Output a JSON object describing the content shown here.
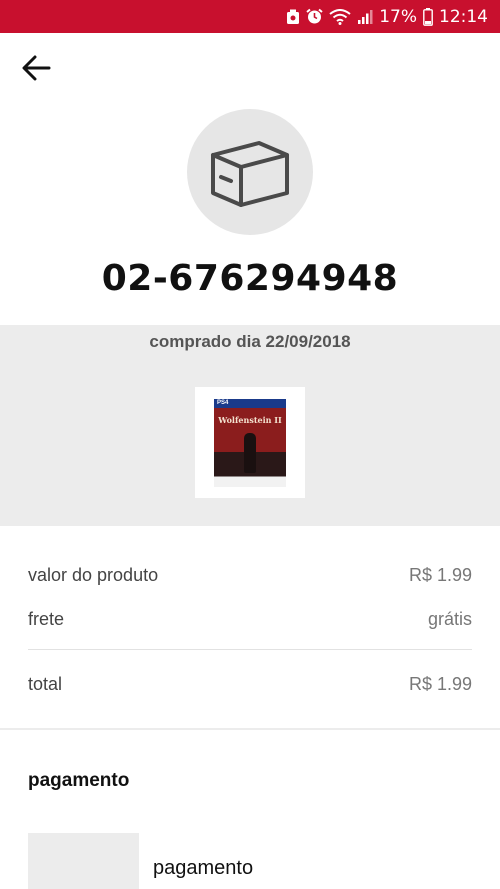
{
  "status_bar": {
    "battery_percent": "17%",
    "time": "12:14",
    "icons": [
      "screenshot-icon",
      "alarm-icon",
      "wifi-icon",
      "signal-icon",
      "battery-icon"
    ],
    "color": "#c8102e"
  },
  "header": {
    "back_icon": "arrow-left-icon"
  },
  "order": {
    "icon": "package-box-icon",
    "number": "02-676294948"
  },
  "purchase": {
    "date_text": "comprado dia 22/09/2018",
    "product_image": "wolfenstein-ii-ps4-cover",
    "cover_platform": "PS4",
    "cover_title": "Wolfenstein II"
  },
  "summary": {
    "product_value_label": "valor do produto",
    "product_value": "R$ 1.99",
    "shipping_label": "frete",
    "shipping_value": "grátis",
    "total_label": "total",
    "total_value": "R$ 1.99"
  },
  "payment": {
    "section_title": "pagamento",
    "method_label": "pagamento"
  }
}
